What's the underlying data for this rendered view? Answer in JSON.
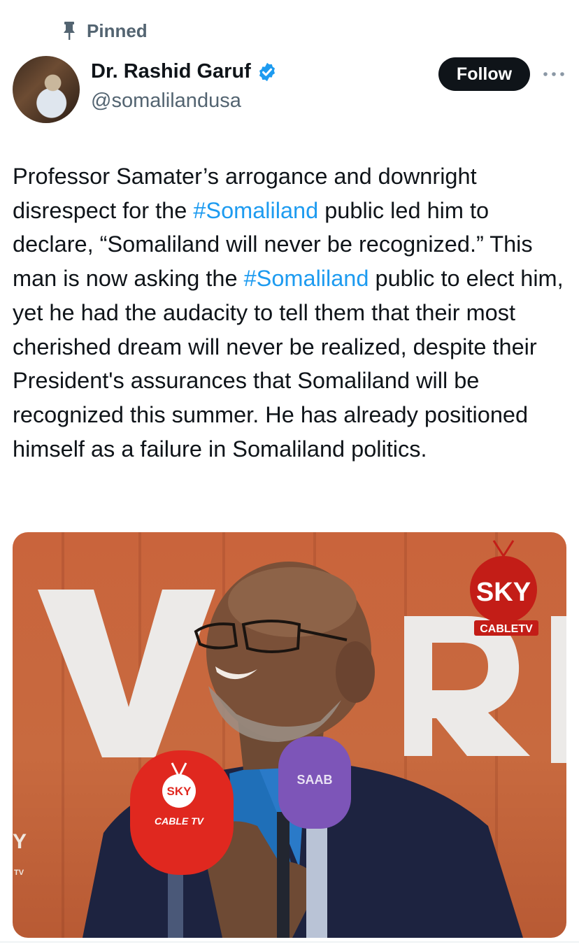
{
  "pinned_label": "Pinned",
  "author": {
    "name": "Dr. Rashid Garuf",
    "handle": "@somalilandusa",
    "verified": true,
    "avatar_icon": "profile-photo"
  },
  "follow_label": "Follow",
  "more_icon": "more-horizontal-icon",
  "tweet": {
    "t1": "Professor Samater’s arrogance and downright disrespect for the ",
    "tag1": "#Somaliland",
    "t2": " public led him to declare, “Somaliland will never be recognized.” This man is now asking the ",
    "tag2": "#Somaliland",
    "t3": " public to elect him, yet he had the audacity to tell them that their most cherished dream will never be realized, despite their President's assurances that Somaliland will be recognized this summer. He has already positioned himself as a failure in Somaliland politics."
  },
  "media": {
    "logo_main": "SKY",
    "logo_sub": "CABLETV",
    "mic1_logo": "SKY",
    "mic1_sub": "CABLE TV",
    "mic2_logo": "SAAB",
    "edge_y": "Y",
    "edge_tv": "TV"
  },
  "colors": {
    "hashtag": "#1d9bf0",
    "follow_bg": "#0f1419",
    "verified": "#1d9bf0",
    "secondary_text": "#536471"
  }
}
